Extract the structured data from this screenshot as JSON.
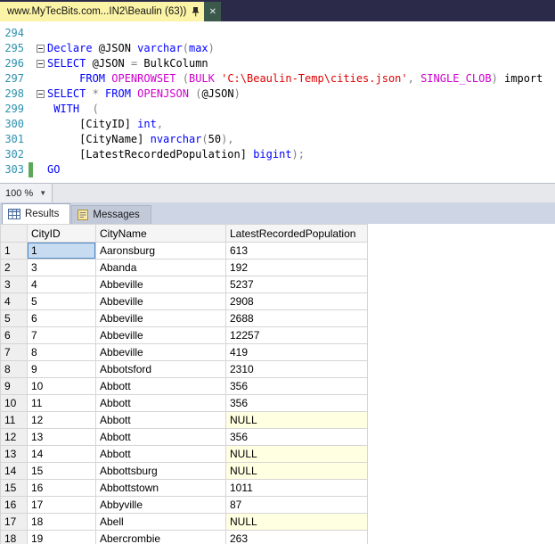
{
  "window": {
    "tab_title": "www.MyTecBits.com...IN2\\Beaulin (63))",
    "close_glyph": "✕"
  },
  "colors": {
    "tab_bar_bg": "#2B2B49",
    "active_tab_bg": "#FBF3A6",
    "keyword": "#0000FF",
    "string": "#E00000",
    "system_function": "#CE00CE",
    "operator": "#7F7F7F",
    "line_number": "#2B91AF",
    "change_bar_green": "#5BA85B",
    "null_cell_bg": "#FFFFE1",
    "selected_cell_bg": "#C7DCF1",
    "selected_cell_border": "#4E86C6"
  },
  "editor": {
    "zoom_label": "100 %",
    "lines": [
      {
        "n": "294",
        "seg": []
      },
      {
        "n": "295",
        "fold": true,
        "seg": [
          [
            "kw",
            "Declare"
          ],
          [
            "pl",
            " @JSON "
          ],
          [
            "kw",
            "varchar"
          ],
          [
            "op",
            "("
          ],
          [
            "kw",
            "max"
          ],
          [
            "op",
            ")"
          ]
        ]
      },
      {
        "n": "296",
        "fold": true,
        "seg": [
          [
            "kw",
            "SELECT"
          ],
          [
            "pl",
            " @JSON "
          ],
          [
            "op",
            "="
          ],
          [
            "pl",
            " BulkColumn"
          ]
        ]
      },
      {
        "n": "297",
        "seg": [
          [
            "pl",
            "     "
          ],
          [
            "kw",
            "FROM"
          ],
          [
            "fn",
            " OPENROWSET "
          ],
          [
            "op",
            "("
          ],
          [
            "fn",
            "BULK"
          ],
          [
            "str",
            " 'C:\\Beaulin-Temp\\cities.json'"
          ],
          [
            "op",
            ","
          ],
          [
            "fn",
            " SINGLE_CLOB"
          ],
          [
            "op",
            ")"
          ],
          [
            "pl",
            " import"
          ]
        ]
      },
      {
        "n": "298",
        "fold": true,
        "seg": [
          [
            "kw",
            "SELECT"
          ],
          [
            "op",
            " * "
          ],
          [
            "kw",
            "FROM"
          ],
          [
            "fn",
            " OPENJSON "
          ],
          [
            "op",
            "("
          ],
          [
            "pl",
            "@JSON"
          ],
          [
            "op",
            ")"
          ]
        ]
      },
      {
        "n": "299",
        "seg": [
          [
            "kw",
            " WITH"
          ],
          [
            "op",
            "  ("
          ]
        ]
      },
      {
        "n": "300",
        "seg": [
          [
            "pl",
            "     [CityID] "
          ],
          [
            "kw",
            "int"
          ],
          [
            "op",
            ","
          ]
        ]
      },
      {
        "n": "301",
        "seg": [
          [
            "pl",
            "     [CityName] "
          ],
          [
            "kw",
            "nvarchar"
          ],
          [
            "op",
            "("
          ],
          [
            "pl",
            "50"
          ],
          [
            "op",
            "),"
          ]
        ]
      },
      {
        "n": "302",
        "seg": [
          [
            "pl",
            "     [LatestRecordedPopulation] "
          ],
          [
            "kw",
            "bigint"
          ],
          [
            "op",
            ");"
          ]
        ]
      },
      {
        "n": "303",
        "change": true,
        "seg": [
          [
            "kw",
            "GO"
          ]
        ]
      }
    ]
  },
  "results_pane": {
    "tabs": [
      {
        "label": "Results",
        "active": true
      },
      {
        "label": "Messages",
        "active": false
      }
    ],
    "grid": {
      "columns": [
        "CityID",
        "CityName",
        "LatestRecordedPopulation"
      ],
      "selected_cell": {
        "row": 1,
        "column": "CityID"
      },
      "rows": [
        [
          "1",
          "Aaronsburg",
          "613"
        ],
        [
          "3",
          "Abanda",
          "192"
        ],
        [
          "4",
          "Abbeville",
          "5237"
        ],
        [
          "5",
          "Abbeville",
          "2908"
        ],
        [
          "6",
          "Abbeville",
          "2688"
        ],
        [
          "7",
          "Abbeville",
          "12257"
        ],
        [
          "8",
          "Abbeville",
          "419"
        ],
        [
          "9",
          "Abbotsford",
          "2310"
        ],
        [
          "10",
          "Abbott",
          "356"
        ],
        [
          "11",
          "Abbott",
          "356"
        ],
        [
          "12",
          "Abbott",
          "NULL"
        ],
        [
          "13",
          "Abbott",
          "356"
        ],
        [
          "14",
          "Abbott",
          "NULL"
        ],
        [
          "15",
          "Abbottsburg",
          "NULL"
        ],
        [
          "16",
          "Abbottstown",
          "1011"
        ],
        [
          "17",
          "Abbyville",
          "87"
        ],
        [
          "18",
          "Abell",
          "NULL"
        ],
        [
          "19",
          "Abercrombie",
          "263"
        ]
      ]
    }
  }
}
